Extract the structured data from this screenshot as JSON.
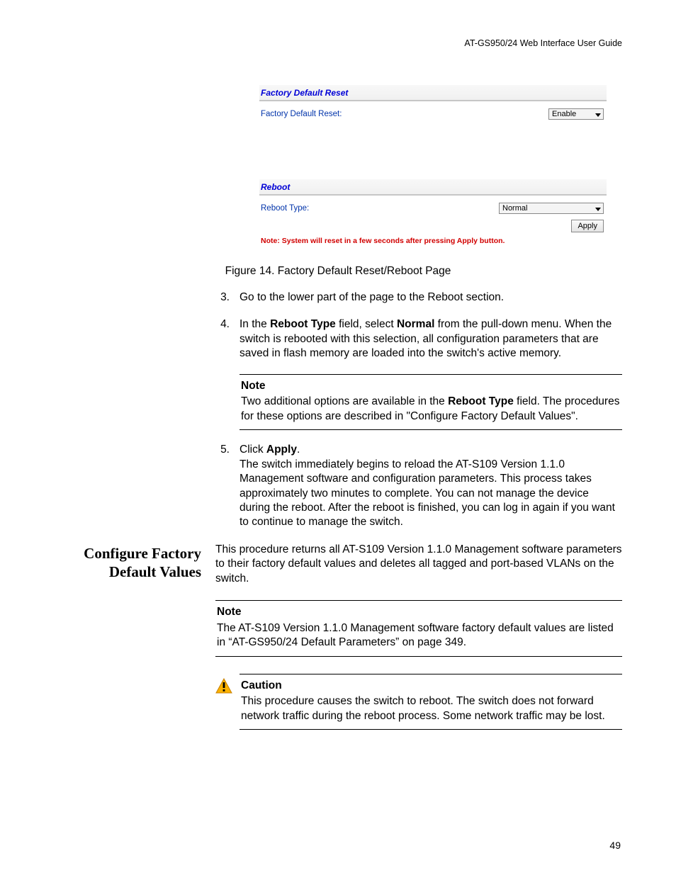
{
  "header": "AT-GS950/24  Web Interface User Guide",
  "screenshot": {
    "section1_title": "Factory Default Reset",
    "s1_label": "Factory Default Reset:",
    "s1_value": "Enable",
    "section2_title": "Reboot",
    "s2_label": "Reboot Type:",
    "s2_value": "Normal",
    "apply_btn": "Apply",
    "red_note": "Note: System will reset in a few seconds after pressing Apply button."
  },
  "figure_caption": "Figure 14. Factory Default Reset/Reboot Page",
  "steps": {
    "n3": "3.",
    "t3": "Go to the lower part of the page to the Reboot section.",
    "n4": "4.",
    "t4a": "In the ",
    "t4b": "Reboot Type",
    "t4c": " field, select ",
    "t4d": "Normal",
    "t4e": " from the pull-down menu. When the switch is rebooted with this selection, all configuration parameters that are saved in flash memory are loaded into the switch's active memory.",
    "note1_title": "Note",
    "note1_a": "Two additional options are available in the ",
    "note1_b": "Reboot Type",
    "note1_c": " field. The procedures for these options are described in \"Configure Factory Default Values\".",
    "n5": "5.",
    "t5a": "Click ",
    "t5b": "Apply",
    "t5c": ".",
    "t5d": "The switch immediately begins to reload the AT-S109 Version 1.1.0 Management software and configuration parameters. This process takes approximately two minutes to complete. You can not manage the device during the reboot. After the reboot is finished, you can log in again if you want to continue to manage the switch."
  },
  "side_heading": "Configure Factory Default Values",
  "right_intro": "This procedure returns all AT-S109 Version 1.1.0  Management software parameters to their factory default values and deletes all tagged and port-based VLANs on the switch.",
  "note2_title": "Note",
  "note2_body": "The AT-S109 Version 1.1.0  Management software factory default values are listed in “AT-GS950/24 Default Parameters” on page 349.",
  "caution_title": "Caution",
  "caution_body": "This procedure causes the switch to reboot. The switch does not forward network traffic during the reboot process. Some network traffic may be lost.",
  "page_number": "49"
}
